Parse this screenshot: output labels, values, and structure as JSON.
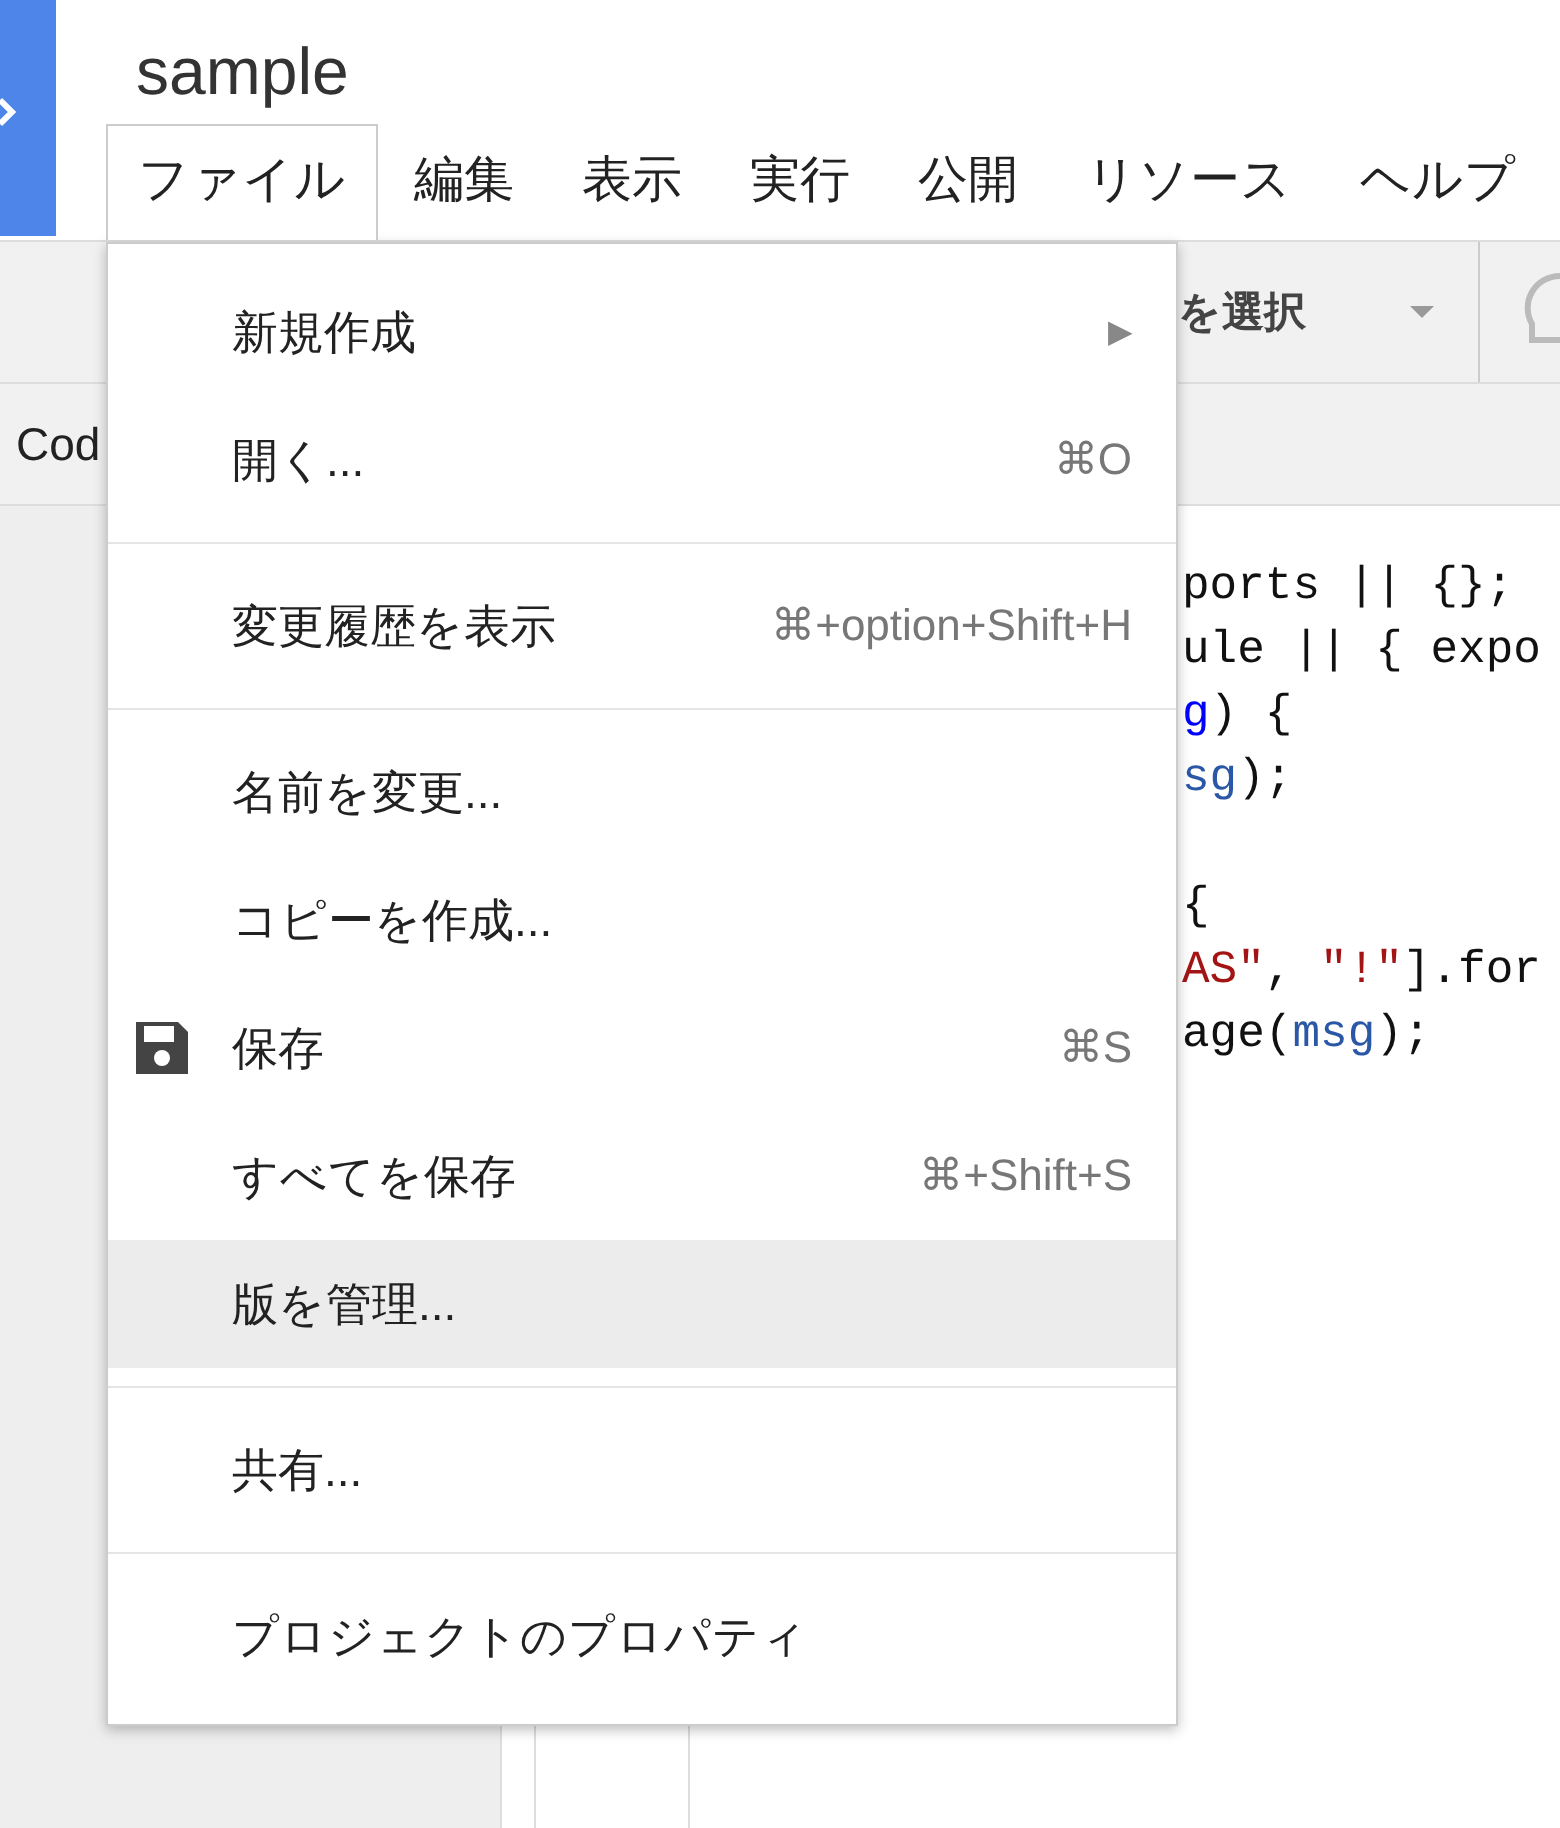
{
  "title": "sample",
  "menu_bar": [
    {
      "label": "ファイル",
      "selected": true
    },
    {
      "label": "編集",
      "selected": false
    },
    {
      "label": "表示",
      "selected": false
    },
    {
      "label": "実行",
      "selected": false
    },
    {
      "label": "公開",
      "selected": false
    },
    {
      "label": "リソース",
      "selected": false
    },
    {
      "label": "ヘルプ",
      "selected": false
    }
  ],
  "toolbar": {
    "function_select": "を選択"
  },
  "file_tab": "Cod",
  "code_lines": [
    [
      {
        "kind": "plain",
        "text": "ports || {};"
      }
    ],
    [
      {
        "kind": "plain",
        "text": "ule || { expo"
      }
    ],
    [
      {
        "kind": "def",
        "text": "g"
      },
      {
        "kind": "plain",
        "text": ") {"
      }
    ],
    [
      {
        "kind": "var",
        "text": "sg"
      },
      {
        "kind": "plain",
        "text": ");"
      }
    ],
    {
      "gap_before": true,
      "tokens": [
        {
          "kind": "plain",
          "text": "{"
        }
      ]
    },
    [
      {
        "kind": "string",
        "text": "AS\""
      },
      {
        "kind": "plain",
        "text": ", "
      },
      {
        "kind": "string",
        "text": "\"!\""
      },
      {
        "kind": "plain",
        "text": "].for"
      }
    ],
    [
      {
        "kind": "plain",
        "text": "age("
      },
      {
        "kind": "var",
        "text": "msg"
      },
      {
        "kind": "plain",
        "text": ");"
      }
    ]
  ],
  "file_menu": [
    [
      {
        "kind": "plain",
        "label": "新規作成",
        "submenu_arrow": "▶",
        "selected": false
      },
      {
        "kind": "plain",
        "label": "開く...",
        "shortcut": "⌘O",
        "selected": false
      }
    ],
    [
      {
        "kind": "plain",
        "label": "変更履歴を表示",
        "shortcut": "⌘+option+Shift+H",
        "selected": false
      }
    ],
    [
      {
        "kind": "plain",
        "label": "名前を変更...",
        "selected": false
      },
      {
        "kind": "plain",
        "label": "コピーを作成...",
        "selected": false
      },
      {
        "kind": "save",
        "label": "保存",
        "shortcut": "⌘S",
        "selected": false
      },
      {
        "kind": "plain",
        "label": "すべてを保存",
        "shortcut": "⌘+Shift+S",
        "selected": false
      },
      {
        "kind": "plain",
        "label": "版を管理...",
        "selected": true
      }
    ],
    [
      {
        "kind": "plain",
        "label": "共有...",
        "selected": false
      }
    ],
    [
      {
        "kind": "plain",
        "label": "プロジェクトのプロパティ",
        "selected": false
      }
    ]
  ]
}
